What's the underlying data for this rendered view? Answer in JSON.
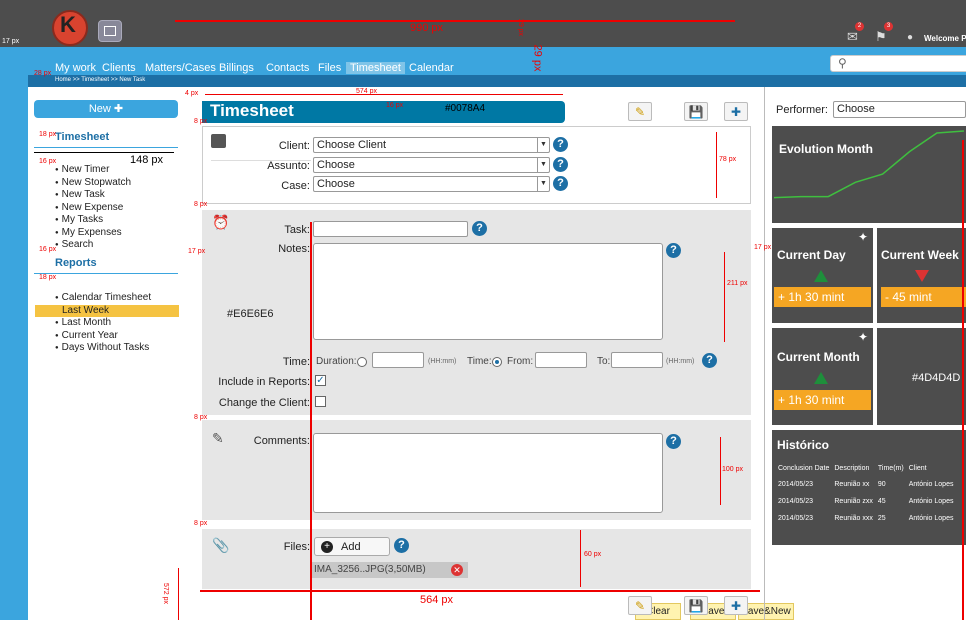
{
  "header": {
    "welcome": "Welcome PH",
    "notif_badges": [
      "2",
      "3"
    ],
    "search_placeholder": ""
  },
  "nav": {
    "items": [
      "My work",
      "Clients",
      "Matters/Cases",
      "Billings",
      "Contacts",
      "Files",
      "Timesheet",
      "Calendar"
    ],
    "active": "Timesheet",
    "breadcrumb": "Home >> Timesheet >> New Task"
  },
  "sidebar": {
    "new_label": "New",
    "timesheet_title": "Timesheet",
    "timesheet_items": [
      "New Timer",
      "New Stopwatch",
      "New Task",
      "New Expense",
      "My Tasks",
      "My Expenses",
      "Search"
    ],
    "reports_title": "Reports",
    "report_items": [
      "Calendar Timesheet",
      "Last Week",
      "Last Month",
      "Current Year",
      "Days Without Tasks"
    ],
    "report_highlight": "Last Week"
  },
  "main": {
    "title": "Timesheet",
    "header_color_hex": "#0078A4",
    "client_label": "Client:",
    "client_value": "Choose Client",
    "assunto_label": "Assunto:",
    "assunto_value": "Choose",
    "case_label": "Case:",
    "case_value": "Choose",
    "task_label": "Task:",
    "notes_label": "Notes:",
    "panel_color_hex": "#E6E6E6",
    "time_label": "Time:",
    "duration_label": "Duration:",
    "hhmm": "(HH:mm)",
    "time2_label": "Time:",
    "from_label": "From:",
    "to_label": "To:",
    "include_label": "Include in Reports:",
    "change_client_label": "Change the Client:",
    "comments_label": "Comments:",
    "files_label": "Files:",
    "add_label": "Add",
    "file_name": "IMA_3256..JPG(3,50MB)",
    "tips": [
      "Clear",
      "Save",
      "Save&New"
    ]
  },
  "annotations": {
    "w990": "990 px",
    "h29": "29 px",
    "h29b": "29 px",
    "w574": "574 px",
    "w148": "148 px",
    "h78": "78 px",
    "h211": "211 px",
    "h100": "100 px",
    "h60": "60 px",
    "w564": "564 px",
    "h572": "572 px",
    "s18a": "18 px",
    "s18b": "18 px",
    "s16a": "16 px",
    "s16b": "16 px",
    "s16c": "16 px",
    "s8a": "8 px",
    "s8b": "8 px",
    "s8c": "8 px",
    "s8d": "8 px",
    "s17a": "17 px",
    "s17b": "17 px",
    "s17c": "17 px",
    "s28": "28 px",
    "s4": "4 px"
  },
  "right": {
    "performer_label": "Performer:",
    "performer_value": "Choose",
    "evolution_title": "Evolution Month",
    "evolution_series": [
      15,
      16,
      16,
      30,
      38,
      60,
      78,
      80
    ],
    "current_day_title": "Current Day",
    "current_day_value": "+ 1h 30 mint",
    "current_week_title": "Current Week",
    "current_week_value": "- 45 mint",
    "current_month_title": "Current Month",
    "current_month_value": "+ 1h 30 mint",
    "widget_color_hex": "#4D4D4D",
    "historico_title": "Histórico",
    "historico_headers": [
      "Conclusion Date",
      "Description",
      "Time(m)",
      "Client"
    ],
    "historico_rows": [
      [
        "2014/05/23",
        "Reunião xx",
        "90",
        "António Lopes"
      ],
      [
        "2014/05/23",
        "Reunião zxx",
        "45",
        "António Lopes"
      ],
      [
        "2014/05/23",
        "Reunião xxx",
        "25",
        "António Lopes"
      ]
    ]
  }
}
